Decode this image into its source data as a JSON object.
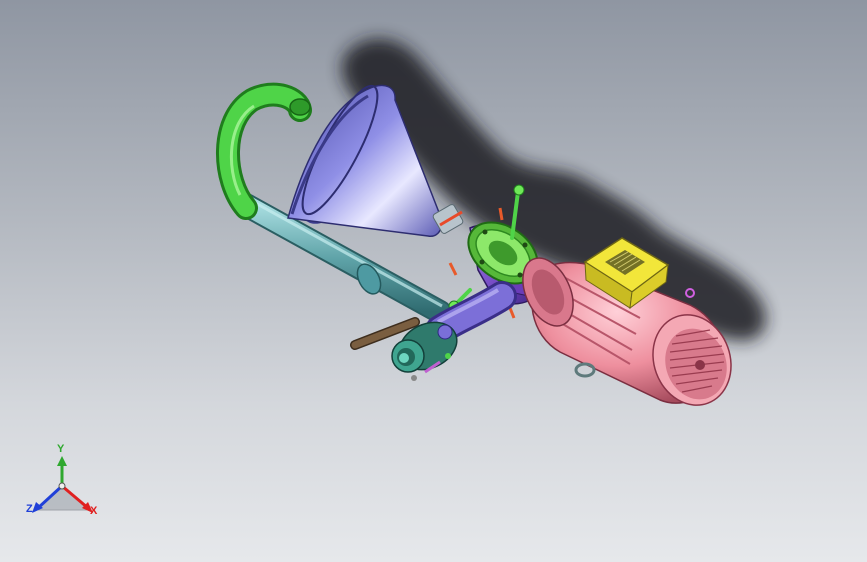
{
  "view": {
    "background_top": "#8f96a2",
    "background_bottom": "#e6e8eb"
  },
  "model": {
    "parts": [
      {
        "name": "funnel-hopper",
        "color": "#6f6fd0"
      },
      {
        "name": "return-pipe-bend",
        "color": "#3ec83a"
      },
      {
        "name": "return-pipe",
        "color": "#5fa3a8"
      },
      {
        "name": "pump-flange",
        "color": "#7ee05a"
      },
      {
        "name": "pump-casing",
        "color": "#7a4fc8"
      },
      {
        "name": "outlet-pipe",
        "color": "#7c6fd8"
      },
      {
        "name": "ball-valve",
        "color": "#3fa590"
      },
      {
        "name": "valve-handle",
        "color": "#6b5238"
      },
      {
        "name": "electric-motor",
        "color": "#ee8f9e"
      },
      {
        "name": "terminal-box",
        "color": "#f2e63a"
      },
      {
        "name": "lifting-eye",
        "color": "#8aa2a4"
      }
    ]
  },
  "triad": {
    "axes": {
      "x": "X",
      "y": "Y",
      "z": "Z"
    },
    "colors": {
      "x": "#e02020",
      "y": "#2fa82f",
      "z": "#2040d8"
    }
  }
}
